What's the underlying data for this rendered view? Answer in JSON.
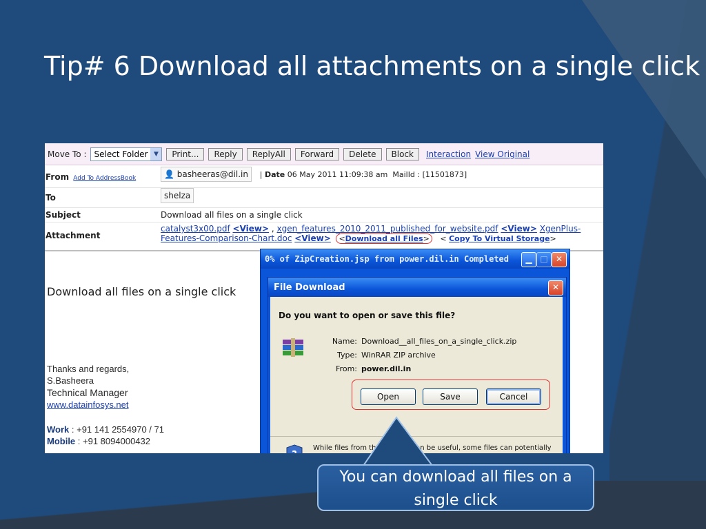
{
  "slide": {
    "title": "Tip# 6 Download all attachments on a single click"
  },
  "toolbar": {
    "move_to_label": "Move To :",
    "folder_select": "Select Folder",
    "buttons": [
      "Print...",
      "Reply",
      "ReplyAll",
      "Forward",
      "Delete",
      "Block"
    ],
    "links": [
      "Interaction",
      "View Original"
    ]
  },
  "mail": {
    "from_label": "From",
    "add_to_addressbook": "Add To AddressBook",
    "from_value": "basheeras@dil.in",
    "date_label": "Date",
    "date_value": "06 May 2011 11:09:38 am",
    "mailid": "MailId : [11501873]",
    "to_label": "To",
    "to_value": "shelza",
    "subject_label": "Subject",
    "subject_value": "Download all files on a single click",
    "attachment_label": "Attachment",
    "file1": "catalyst3x00.pdf",
    "view": "<View>",
    "sep": ",",
    "file2": "xgen_features_2010_2011_published_for_website.pdf",
    "file3a": "XgenPlus-",
    "file3b": "Features-Comparison-Chart.doc",
    "download_all": "Download all Files",
    "copy_virtual": "Copy To Virtual Storage",
    "lt": "<",
    "gt": ">"
  },
  "message": {
    "body": "Download all files on a single click",
    "sig1": "Thanks and regards,",
    "sig2": "S.Basheera",
    "sig3": "Technical Manager",
    "sig_link": "www.datainfosys.net",
    "work_label": "Work",
    "work_value": ": +91 141 2554970 / 71",
    "mobile_label": "Mobile",
    "mobile_value": ": +91 8094000432"
  },
  "progress_window": {
    "title": "0% of ZipCreation.jsp from power.dil.in Completed"
  },
  "file_download": {
    "title": "File Download",
    "question": "Do you want to open or save this file?",
    "name_label": "Name:",
    "name_value": "Download__all_files_on_a_single_click.zip",
    "type_label": "Type:",
    "type_value": "WinRAR ZIP archive",
    "from_label": "From:",
    "from_value": "power.dil.in",
    "open": "Open",
    "save": "Save",
    "cancel": "Cancel",
    "warning": "While files from the Internet can be useful, some files can potentially harm your computer. If you do not trust the source, do not open or"
  },
  "callout": {
    "line1": "You can download all files on a",
    "line2": "single click"
  },
  "colors": {
    "slide_bg": "#1f4a7c",
    "xp_blue": "#0a55d8",
    "link": "#1a3fb0",
    "callout_border": "#9ec0e6"
  }
}
